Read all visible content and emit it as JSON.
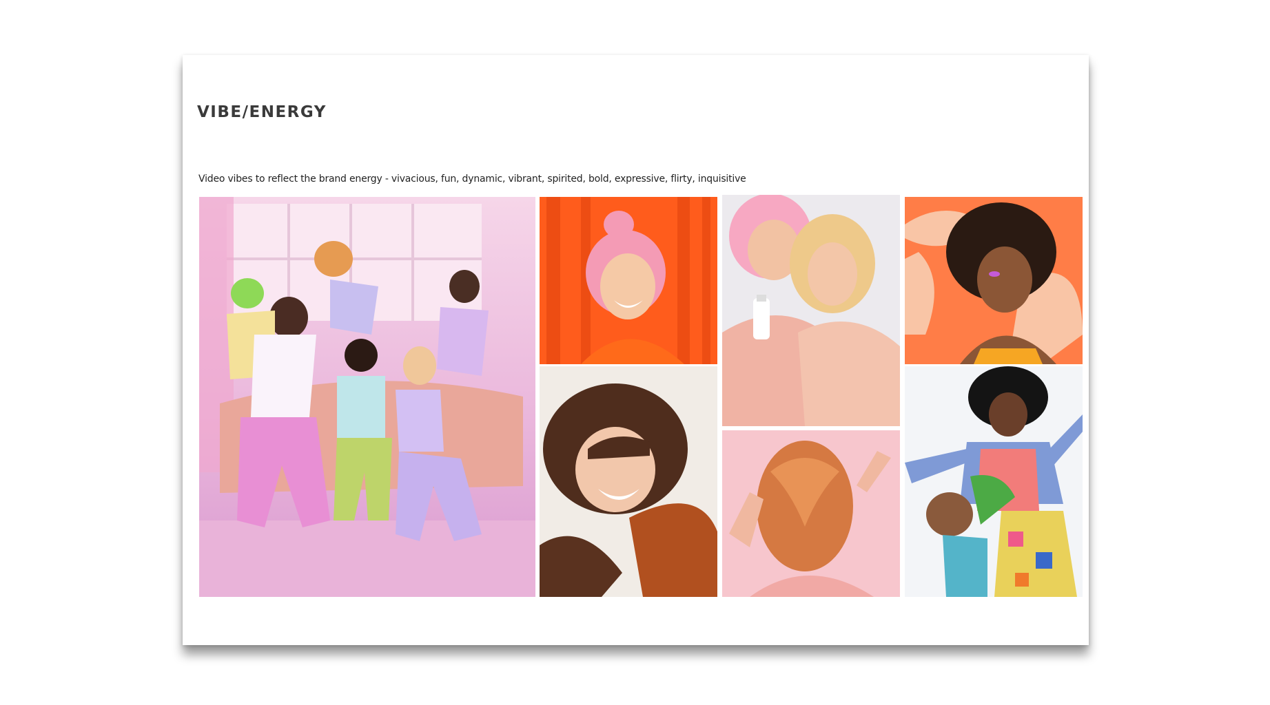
{
  "slide": {
    "title": "VIBE/ENERGY",
    "subtitle": "Video vibes to reflect the brand energy - vivacious, fun, dynamic, vibrant, spirited, bold, expressive, flirty, inquisitive"
  },
  "photos": [
    {
      "subject": "group of friends laughing on pink sofa",
      "palette": [
        "#f2b8de",
        "#d98fd8",
        "#e7a37c"
      ]
    },
    {
      "subject": "woman with pink bun hair smiling against orange curtain",
      "palette": [
        "#ff5a1f",
        "#f7a3b8"
      ]
    },
    {
      "subject": "two women hugging holding product bottle",
      "palette": [
        "#f3f2f5",
        "#f5a9c0",
        "#f0c98f"
      ]
    },
    {
      "subject": "woman with curly hair on orange pattern background",
      "palette": [
        "#ff7a45",
        "#f8c3a6",
        "#2b1a14"
      ]
    },
    {
      "subject": "brunette woman laughing with hair in motion",
      "palette": [
        "#f1ebe6",
        "#5a3421",
        "#b24e1f"
      ]
    },
    {
      "subject": "woman flipping copper hair on pink background",
      "palette": [
        "#f7c5cc",
        "#d77a44"
      ]
    },
    {
      "subject": "two women posing in colorful patterned outfits",
      "palette": [
        "#f4f6f9",
        "#141414",
        "#f27c7a"
      ]
    }
  ]
}
